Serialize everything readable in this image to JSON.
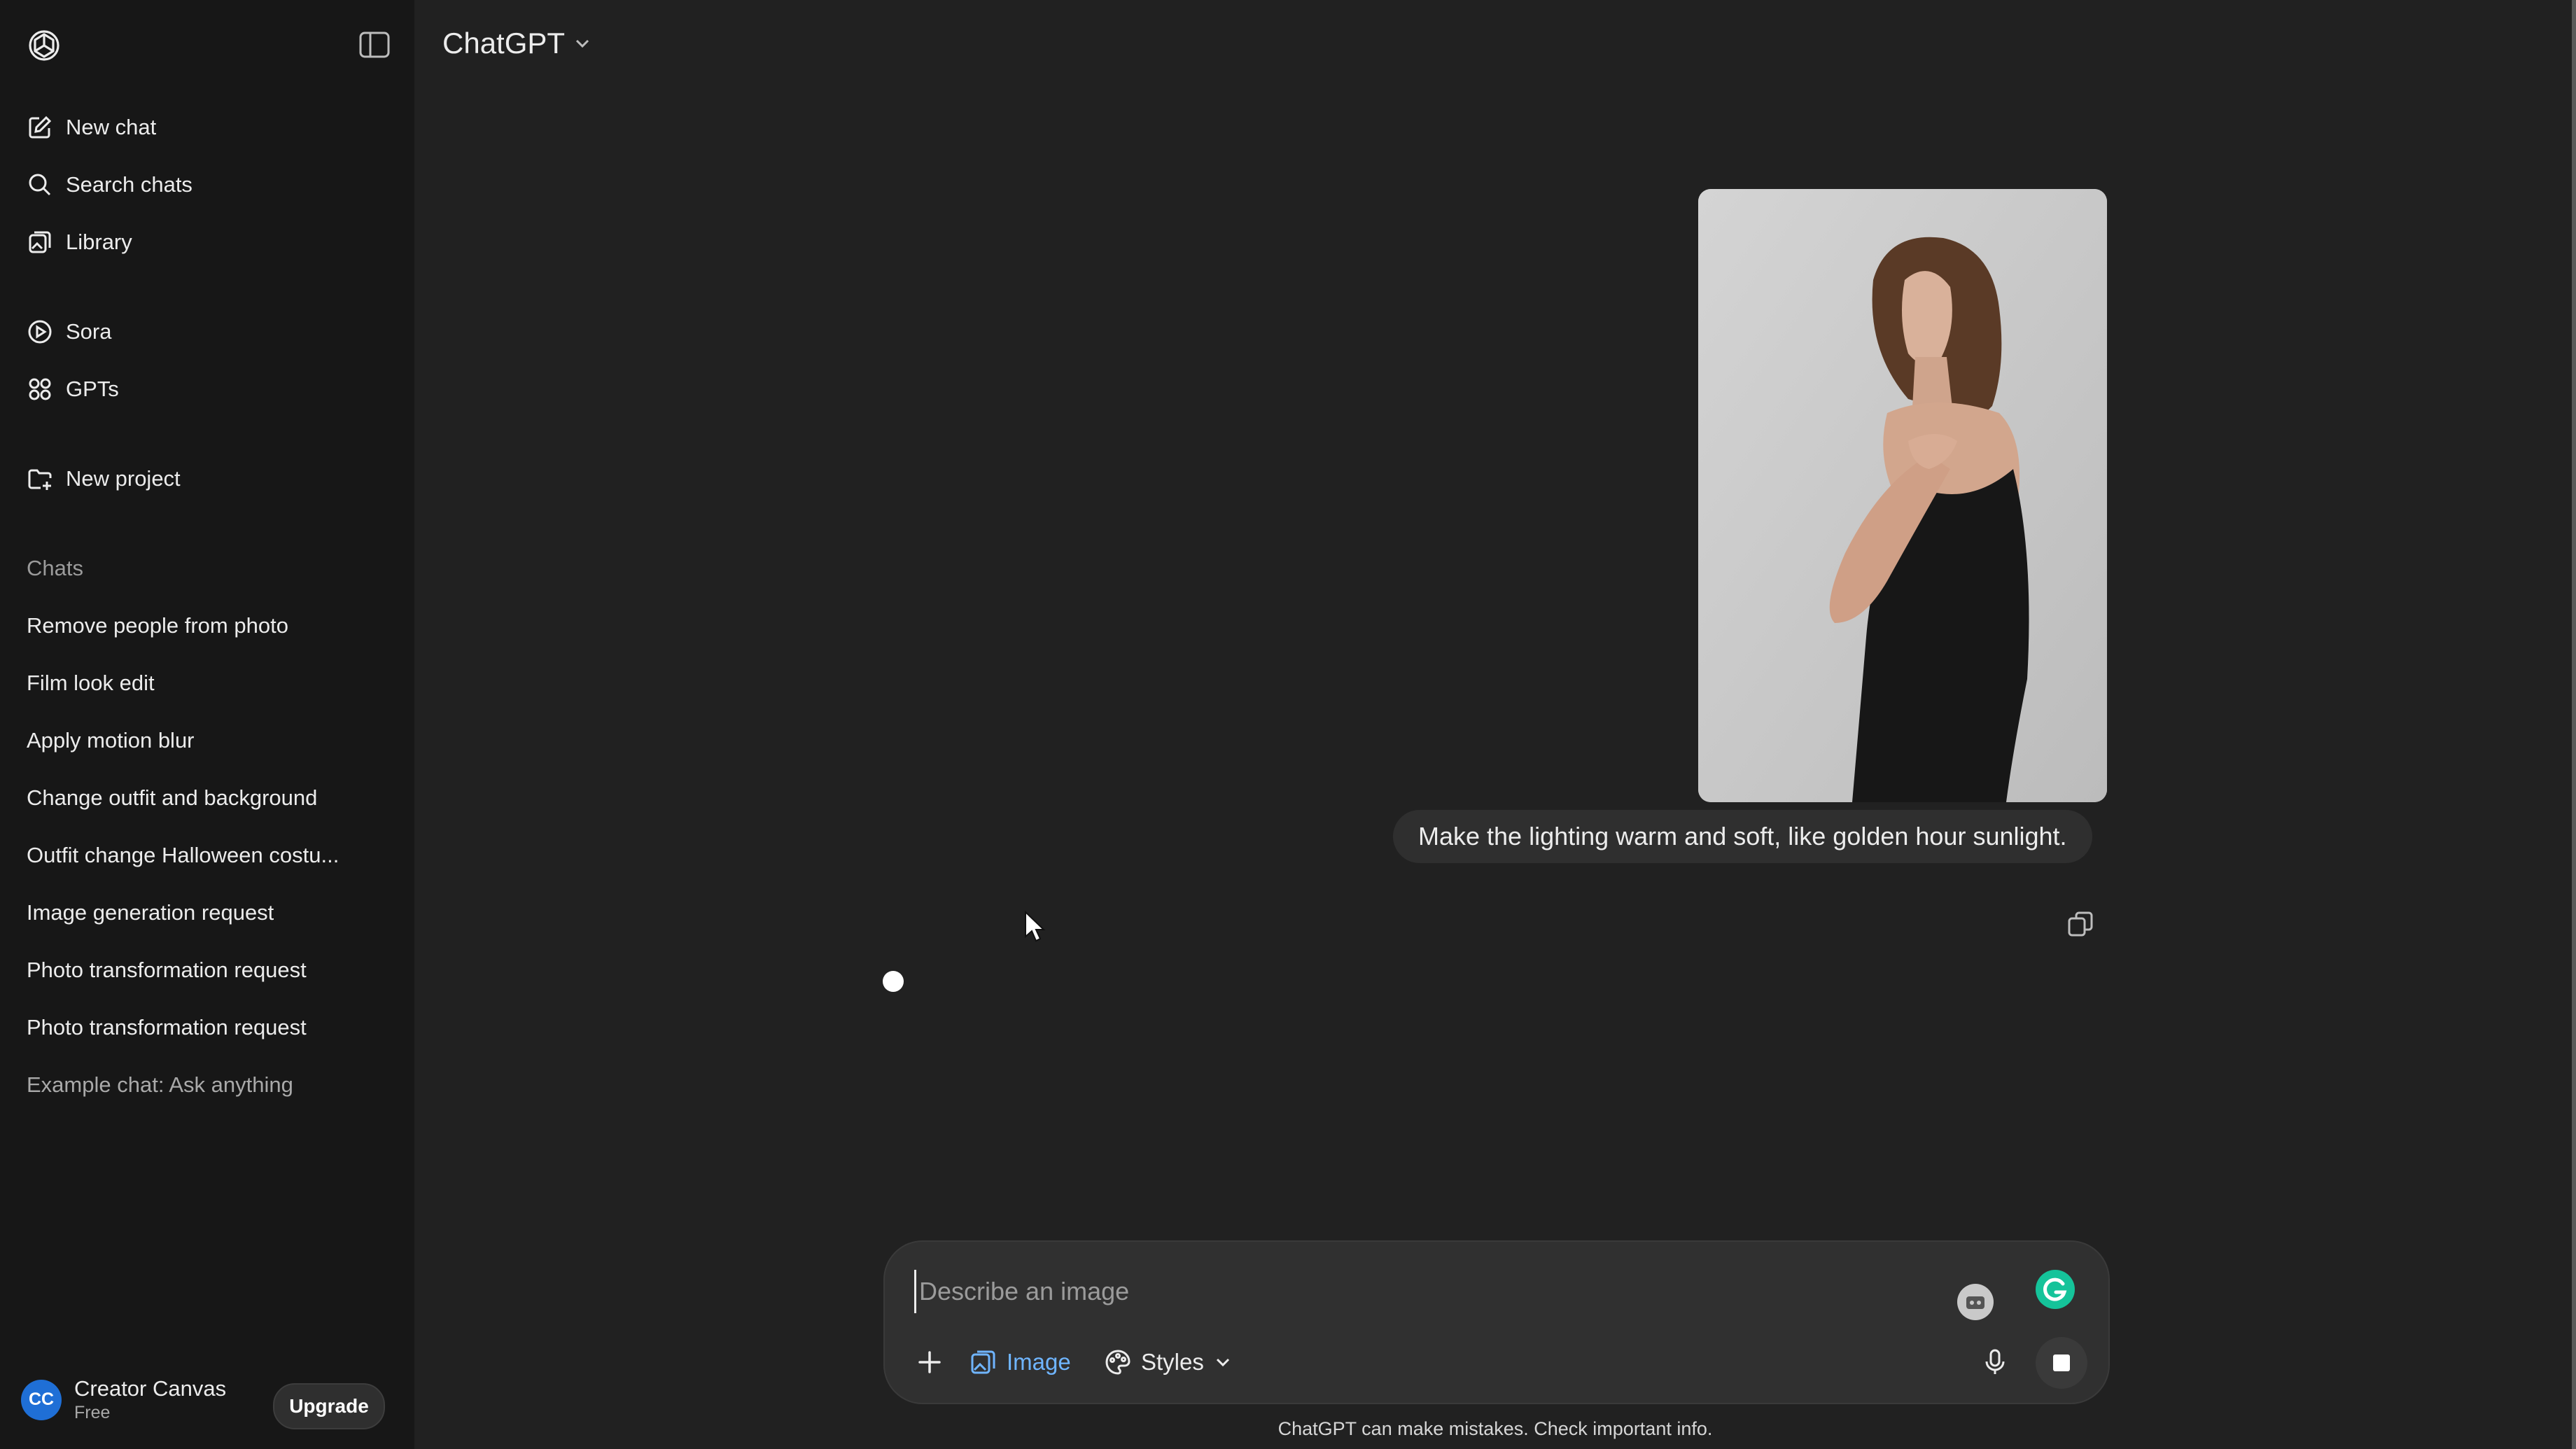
{
  "sidebar": {
    "nav": [
      {
        "label": "New chat",
        "icon": "pencil-square-icon"
      },
      {
        "label": "Search chats",
        "icon": "search-icon"
      },
      {
        "label": "Library",
        "icon": "images-icon"
      },
      {
        "label": "Sora",
        "icon": "play-circle-icon"
      },
      {
        "label": "GPTs",
        "icon": "grid-icon"
      },
      {
        "label": "New project",
        "icon": "folder-plus-icon"
      }
    ],
    "chats_heading": "Chats",
    "chats": [
      "Remove people from photo",
      "Film look edit",
      "Apply motion blur",
      "Change outfit and background",
      "Outfit change Halloween costu...",
      "Image generation request",
      "Photo transformation request",
      "Photo transformation request",
      "Example chat: Ask anything"
    ],
    "user": {
      "initials": "CC",
      "name": "Creator Canvas",
      "plan": "Free"
    },
    "upgrade_label": "Upgrade"
  },
  "header": {
    "model": "ChatGPT"
  },
  "conversation": {
    "user_message": "Make the lighting warm and soft, like golden hour sunlight."
  },
  "composer": {
    "placeholder": "Describe an image",
    "image_label": "Image",
    "styles_label": "Styles"
  },
  "footer": {
    "disclaimer": "ChatGPT can make mistakes. Check important info."
  },
  "colors": {
    "background": "#212121",
    "sidebar": "#171717",
    "accent": "#6fb5ff",
    "avatar": "#1f6fd6"
  }
}
